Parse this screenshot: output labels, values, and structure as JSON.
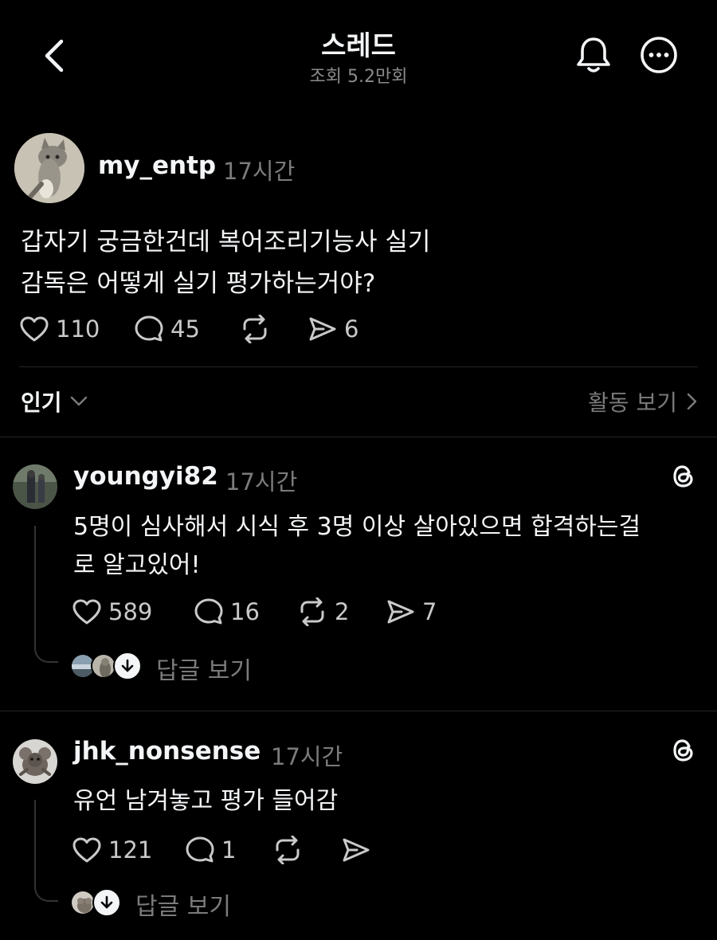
{
  "header": {
    "title": "스레드",
    "views": "조회 5.2만회"
  },
  "post": {
    "username": "my_entp",
    "time": "17시간",
    "text_line1": "갑자기 궁금한건데 복어조리기능사 실기",
    "text_line2": "감독은 어떻게 실기 평가하는거야?",
    "likes": "110",
    "comments": "45",
    "shares": "6"
  },
  "sort": {
    "label": "인기",
    "activity_label": "활동 보기"
  },
  "comments": [
    {
      "username": "youngyi82",
      "time": "17시간",
      "line1": "5명이 심사해서 시식 후 3명 이상 살아있으면 합격하는걸",
      "line2": "로 알고있어!",
      "likes": "589",
      "comments": "16",
      "reposts": "2",
      "shares": "7",
      "replies_label": "답글 보기"
    },
    {
      "username": "jhk_nonsense",
      "time": "17시간",
      "line1": "유언 남겨놓고 평가 들어감",
      "likes": "121",
      "comments": "1",
      "replies_label": "답글 보기"
    }
  ],
  "icons": {
    "back": "chevron-left-icon",
    "bell": "bell-icon",
    "more": "more-icon",
    "like": "heart-icon",
    "comment": "comment-icon",
    "repost": "repost-icon",
    "share": "send-icon",
    "threads": "threads-logo-icon"
  },
  "colors": {
    "background": "#000000",
    "text": "#f3f5f7",
    "muted": "#7b7b7b",
    "divider": "#262626"
  }
}
